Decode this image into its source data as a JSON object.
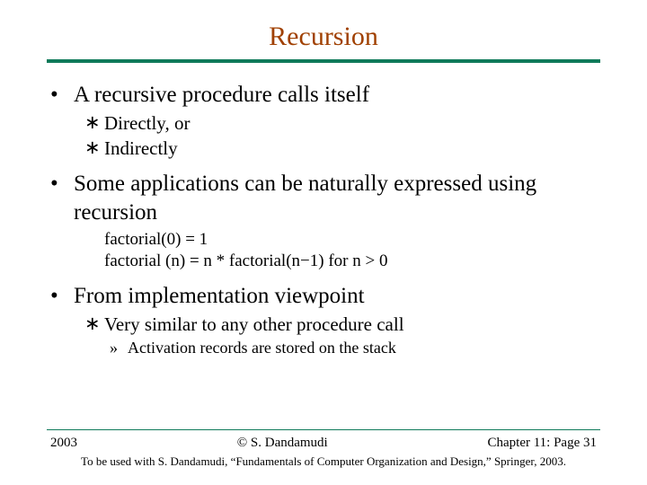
{
  "title": "Recursion",
  "bullets": {
    "p1": "A recursive procedure calls itself",
    "p1a": "Directly, or",
    "p1b": "Indirectly",
    "p2": "Some applications can be naturally expressed using recursion",
    "p2_code1": "factorial(0) = 1",
    "p2_code2": "factorial (n) = n * factorial(n−1) for n > 0",
    "p3": "From implementation viewpoint",
    "p3a": "Very similar to any other procedure call",
    "p3a1": "Activation records are stored on the stack"
  },
  "footer": {
    "year": "2003",
    "copyright": "© S. Dandamudi",
    "page": "Chapter 11: Page 31",
    "credit": "To be used with S. Dandamudi, “Fundamentals of Computer Organization and Design,” Springer, 2003."
  }
}
